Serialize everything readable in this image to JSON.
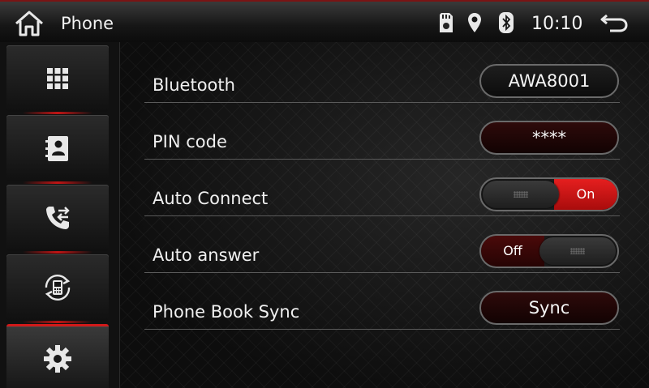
{
  "header": {
    "title": "Phone",
    "time": "10:10",
    "icons": [
      "home-icon",
      "sd-card-icon",
      "location-pin-icon",
      "bluetooth-icon",
      "back-icon"
    ]
  },
  "sidebar": {
    "items": [
      {
        "name": "dialpad",
        "icon": "dialpad-grid-icon",
        "active": false
      },
      {
        "name": "contacts",
        "icon": "contacts-book-icon",
        "active": false
      },
      {
        "name": "call-log",
        "icon": "call-transfer-icon",
        "active": false
      },
      {
        "name": "phone-sync",
        "icon": "phone-sync-icon",
        "active": false
      },
      {
        "name": "settings",
        "icon": "gear-icon",
        "active": true
      }
    ]
  },
  "settings": {
    "bluetooth_label": "Bluetooth",
    "bluetooth_value": "AWA8001",
    "pin_label": "PIN code",
    "pin_value": "****",
    "auto_connect_label": "Auto Connect",
    "auto_connect_state": "On",
    "auto_answer_label": "Auto answer",
    "auto_answer_state": "Off",
    "phonebook_label": "Phone Book Sync",
    "phonebook_button": "Sync"
  },
  "colors": {
    "accent_red": "#d21a1a",
    "pill_dark_red": "#2e0a0a",
    "background": "#121212"
  }
}
